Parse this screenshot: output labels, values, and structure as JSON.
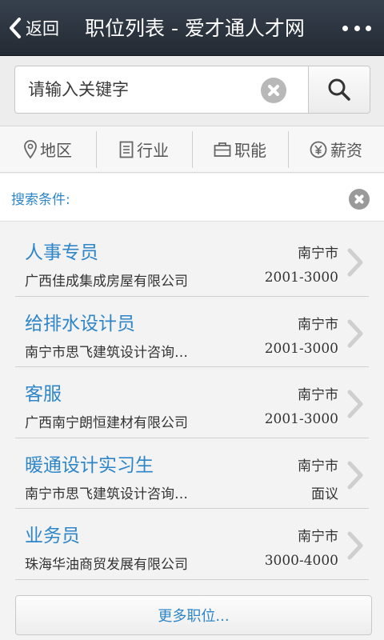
{
  "header": {
    "back_label": "返回",
    "title": "职位列表 - 爱才通人才网",
    "menu_icon": "more-dots-icon"
  },
  "search": {
    "placeholder": "请输入关键字",
    "value": "",
    "clear_icon": "clear-icon",
    "search_icon": "search-icon"
  },
  "filters": [
    {
      "label": "地区",
      "icon": "location-pin-icon"
    },
    {
      "label": "行业",
      "icon": "document-icon"
    },
    {
      "label": "职能",
      "icon": "briefcase-icon"
    },
    {
      "label": "薪资",
      "icon": "yen-icon"
    }
  ],
  "conditions": {
    "label": "搜索条件:",
    "clear_icon": "close-circle-icon"
  },
  "jobs": [
    {
      "title": "人事专员",
      "city": "南宁市",
      "company": "广西佳成集成房屋有限公司",
      "salary": "2001-3000"
    },
    {
      "title": "给排水设计员",
      "city": "南宁市",
      "company": "南宁市思飞建筑设计咨询…",
      "salary": "2001-3000"
    },
    {
      "title": "客服",
      "city": "南宁市",
      "company": "广西南宁朗恒建材有限公司",
      "salary": "2001-3000"
    },
    {
      "title": "暖通设计实习生",
      "city": "南宁市",
      "company": "南宁市思飞建筑设计咨询…",
      "salary": "面议"
    },
    {
      "title": "业务员",
      "city": "南宁市",
      "company": "珠海华油商贸发展有限公司",
      "salary": "3000-4000"
    }
  ],
  "more_button": "更多职位...",
  "colors": {
    "accent": "#2e86c8",
    "nav_bg": "#2b333d"
  }
}
